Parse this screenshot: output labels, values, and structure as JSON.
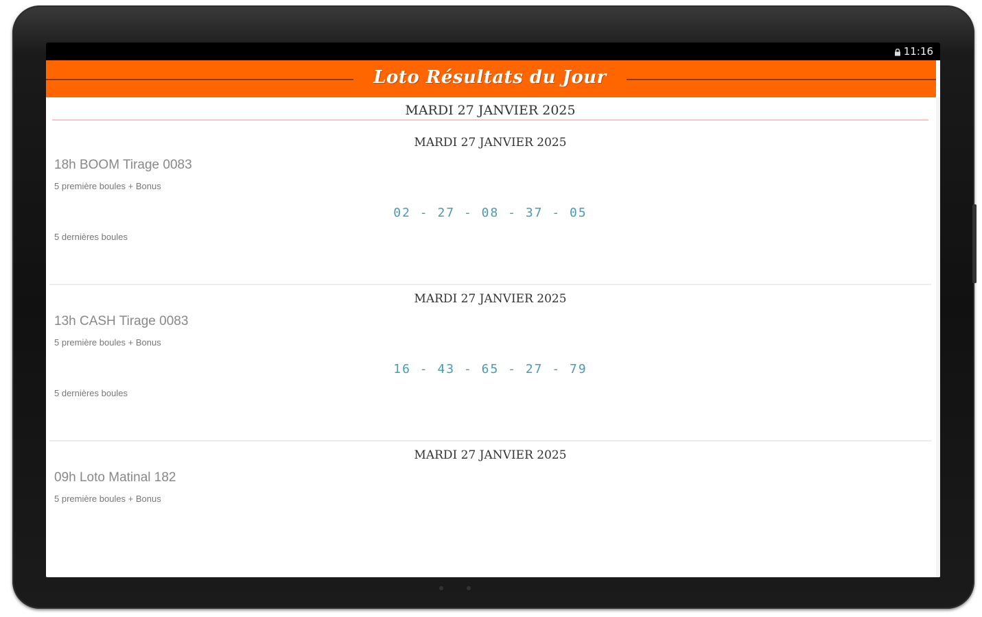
{
  "status_bar": {
    "time": "11:16",
    "lock_icon": "lock-icon"
  },
  "app_bar": {
    "title": "Loto Résultats du Jour",
    "color": "#ff6600"
  },
  "header": {
    "date": "MARDI 27 JANVIER 2025"
  },
  "results": [
    {
      "date": "MARDI 27 JANVIER 2025",
      "draw_name": "18h BOOM Tirage 0083",
      "first_label": "5 première boules + Bonus",
      "numbers": "02 - 27 - 08 - 37 - 05",
      "last_label": "5 dernières boules"
    },
    {
      "date": "MARDI 27 JANVIER 2025",
      "draw_name": "13h CASH Tirage 0083",
      "first_label": "5 première boules + Bonus",
      "numbers": "16 - 43 - 65 - 27 - 79",
      "last_label": "5 dernières boules"
    },
    {
      "date": "MARDI 27 JANVIER 2025",
      "draw_name": "09h Loto Matinal 182",
      "first_label": "5 première boules + Bonus",
      "numbers": "",
      "last_label": ""
    }
  ]
}
